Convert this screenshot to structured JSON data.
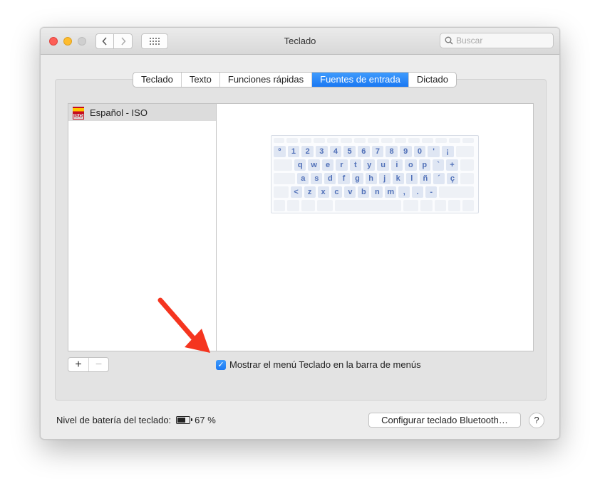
{
  "window": {
    "title": "Teclado"
  },
  "search": {
    "placeholder": "Buscar"
  },
  "tabs": [
    {
      "label": "Teclado"
    },
    {
      "label": "Texto"
    },
    {
      "label": "Funciones rápidas"
    },
    {
      "label": "Fuentes de entrada",
      "active": true
    },
    {
      "label": "Dictado"
    }
  ],
  "input_sources": [
    {
      "label": "Español - ISO",
      "flag_text": "ISO"
    }
  ],
  "keyboard": {
    "row1": [
      "º",
      "1",
      "2",
      "3",
      "4",
      "5",
      "6",
      "7",
      "8",
      "9",
      "0",
      "'",
      "¡"
    ],
    "row2": [
      "q",
      "w",
      "e",
      "r",
      "t",
      "y",
      "u",
      "i",
      "o",
      "p",
      "`",
      "+"
    ],
    "row3": [
      "a",
      "s",
      "d",
      "f",
      "g",
      "h",
      "j",
      "k",
      "l",
      "ñ",
      "´",
      "ç"
    ],
    "row4": [
      "<",
      "z",
      "x",
      "c",
      "v",
      "b",
      "n",
      "m",
      ",",
      ".",
      "-"
    ]
  },
  "buttons": {
    "add": "+",
    "remove": "−",
    "bluetooth": "Configurar teclado Bluetooth…",
    "help": "?"
  },
  "checkbox": {
    "label": "Mostrar el menú Teclado en la barra de menús",
    "checked": true,
    "mark": "✓"
  },
  "battery": {
    "label": "Nivel de batería del teclado:",
    "value": "67 %",
    "level": 0.67
  },
  "colors": {
    "accent": "#1a78f2",
    "annotation_arrow": "#f5351f"
  }
}
